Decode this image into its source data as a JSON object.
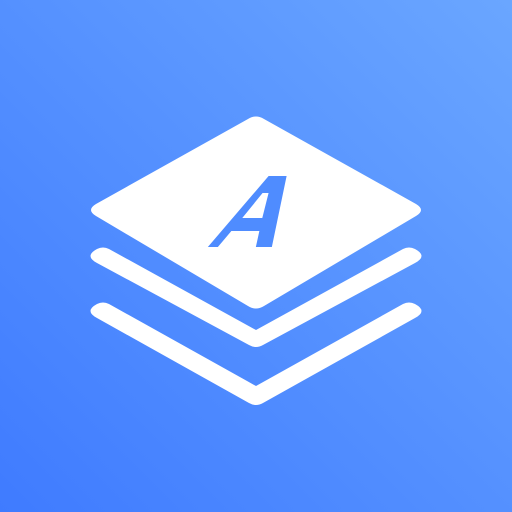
{
  "app_icon": {
    "name": "stacked-layers-letter-a-icon",
    "background_gradient": {
      "top_right": "#6aa6ff",
      "bottom_left": "#3f7bff"
    },
    "foreground_color": "#ffffff",
    "layer_count": 3,
    "glyph": {
      "letter": "A",
      "style": "italic-slanted"
    }
  }
}
